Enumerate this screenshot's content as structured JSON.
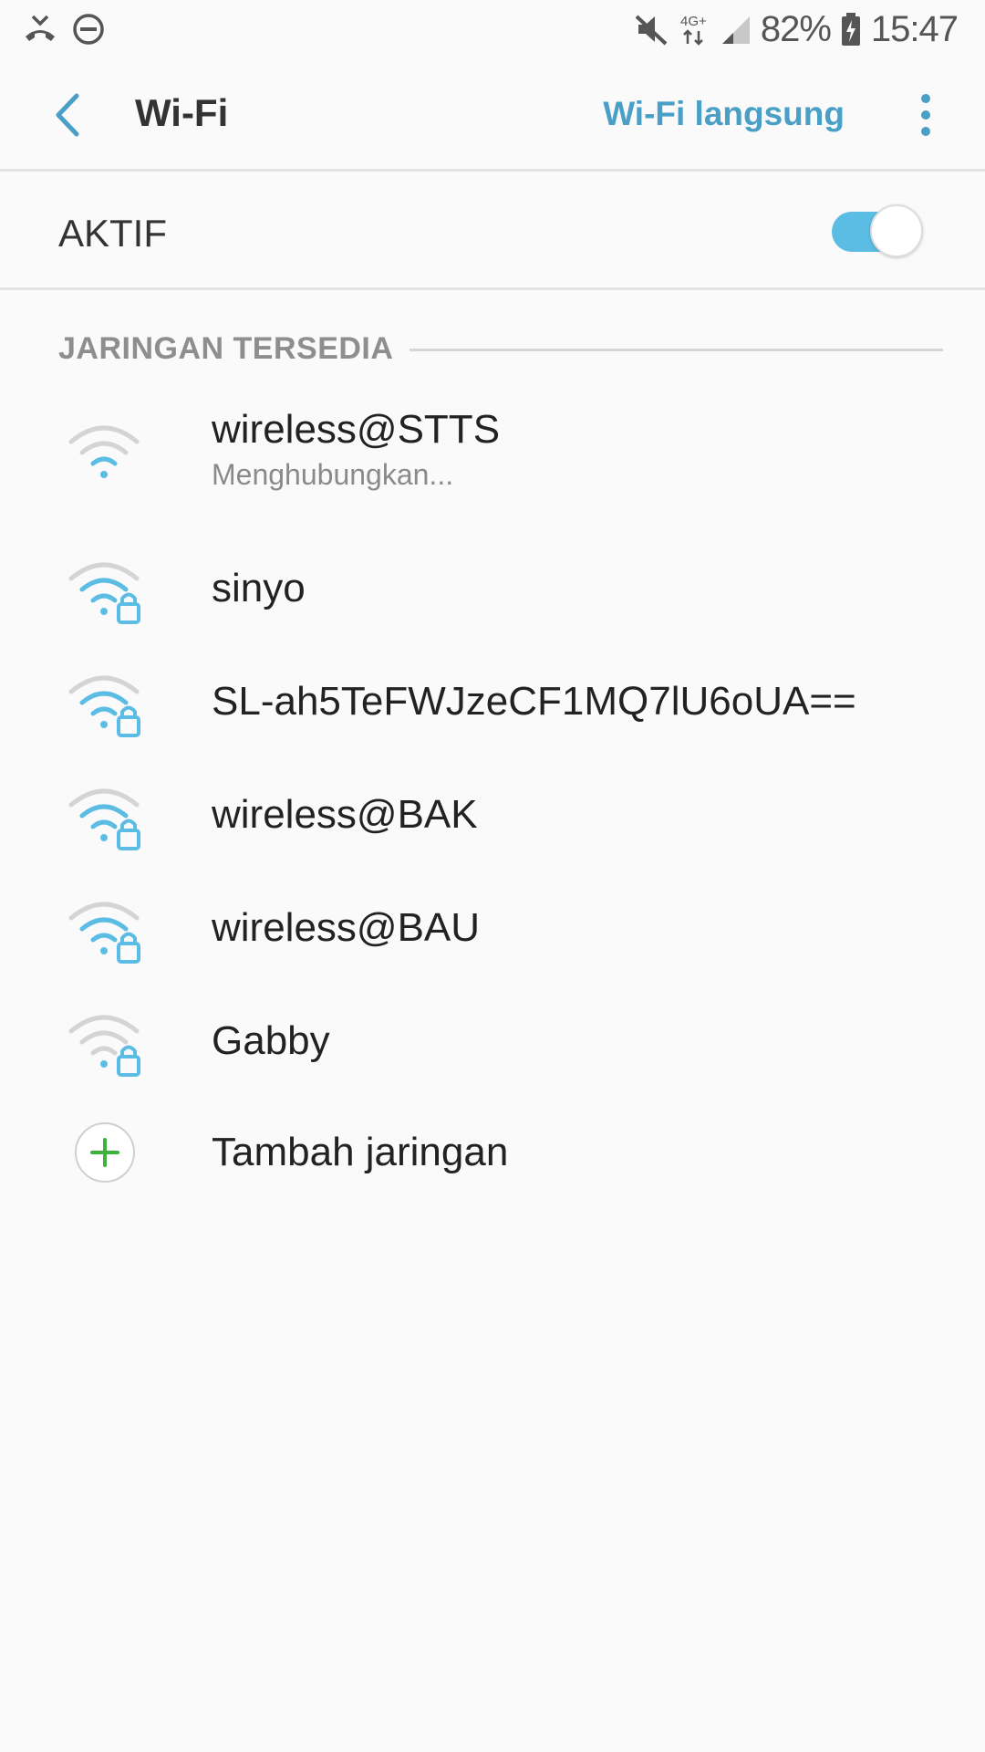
{
  "status_bar": {
    "left_icons": [
      "missed-call-icon",
      "do-not-disturb-icon"
    ],
    "right_icons": [
      "mute-icon",
      "network-4g-icon",
      "signal-icon",
      "battery-charging-icon"
    ],
    "network_label": "4G+",
    "battery": "82%",
    "time": "15:47"
  },
  "appbar": {
    "title": "Wi-Fi",
    "direct_label": "Wi-Fi langsung"
  },
  "toggle": {
    "label": "AKTIF",
    "state": "on",
    "accent_color": "#5bbde4"
  },
  "section": {
    "title": "JARINGAN TERSEDIA"
  },
  "networks": [
    {
      "name": "wireless@STTS",
      "status": "Menghubungkan...",
      "secured": false,
      "signal": 1
    },
    {
      "name": "sinyo",
      "status": "",
      "secured": true,
      "signal": 3
    },
    {
      "name": "SL-ah5TeFWJzeCF1MQ7lU6oUA==",
      "status": "",
      "secured": true,
      "signal": 3
    },
    {
      "name": "wireless@BAK",
      "status": "",
      "secured": true,
      "signal": 3
    },
    {
      "name": "wireless@BAU",
      "status": "",
      "secured": true,
      "signal": 3
    },
    {
      "name": "Gabby",
      "status": "",
      "secured": true,
      "signal": 1
    }
  ],
  "add_network": {
    "label": "Tambah jaringan",
    "icon": "plus-icon"
  },
  "colors": {
    "accent": "#4a9fc6",
    "wifi_active": "#5bbde4",
    "wifi_inactive": "#d4d4d4",
    "add_icon": "#3db33d"
  }
}
